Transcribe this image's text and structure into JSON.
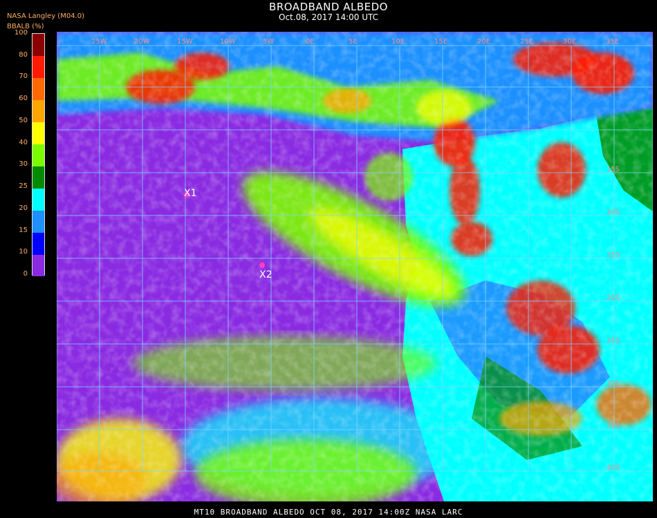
{
  "header": {
    "title": "BROADBAND ALBEDO",
    "subtitle": "Oct.08, 2017 14:00 UTC",
    "organization": "NASA Langley (M04.0)",
    "unit_label": "BBALB (%)"
  },
  "colorbar": {
    "ticks": [
      "100",
      "80",
      "70",
      "60",
      "50",
      "40",
      "30",
      "25",
      "20",
      "15",
      "10",
      "0"
    ],
    "segments": [
      {
        "from": 0,
        "to": 10,
        "color": "#8a2be2"
      },
      {
        "from": 10,
        "to": 15,
        "color": "#0000ff"
      },
      {
        "from": 15,
        "to": 20,
        "color": "#1e90ff"
      },
      {
        "from": 20,
        "to": 25,
        "color": "#00ffff"
      },
      {
        "from": 25,
        "to": 30,
        "color": "#008b00"
      },
      {
        "from": 30,
        "to": 40,
        "color": "#7cfc00"
      },
      {
        "from": 40,
        "to": 50,
        "color": "#ffff00"
      },
      {
        "from": 50,
        "to": 60,
        "color": "#ffa500"
      },
      {
        "from": 60,
        "to": 70,
        "color": "#ff6a00"
      },
      {
        "from": 70,
        "to": 80,
        "color": "#ff1a00"
      },
      {
        "from": 80,
        "to": 100,
        "color": "#8b0000"
      }
    ]
  },
  "map": {
    "markers": [
      {
        "label": "X1"
      },
      {
        "label": "X2"
      }
    ],
    "lon_labels": [
      "25W",
      "20W",
      "15W",
      "10W",
      "5W",
      "0E",
      "5E",
      "10E",
      "15E",
      "20E",
      "25E",
      "30E",
      "35E"
    ],
    "lat_labels": [
      "15S",
      "10S",
      "15S",
      "20S",
      "25S",
      "30S",
      "35S",
      "40S"
    ],
    "grid_color": "#7fd4ff"
  },
  "footer": {
    "text": "MT10  BROADBAND ALBEDO   OCT 08, 2017 14:00Z   NASA LARC"
  }
}
